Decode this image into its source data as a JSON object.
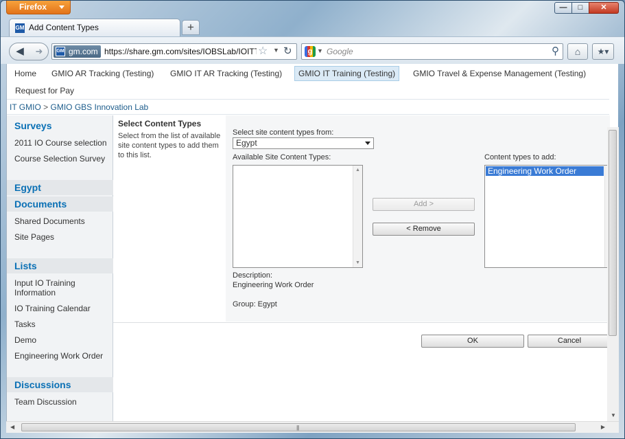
{
  "browser": {
    "menu_button": "Firefox",
    "window_controls": {
      "minimize": "—",
      "maximize": "□",
      "close": "✕"
    },
    "tab": {
      "title": "Add Content Types",
      "favicon_text": "GM"
    },
    "new_tab": "+",
    "identity_label": "gm.com",
    "identity_icon_text": "GM",
    "url": "https://share.gm.com/sites/IOBSLab/IOITT",
    "search_placeholder": "Google",
    "search_engine_icon": "g",
    "icons": {
      "back": "back-arrow-icon",
      "forward": "forward-arrow-icon",
      "star": "bookmark-star-icon",
      "reload": "reload-icon",
      "search": "magnifier-icon",
      "home": "home-icon",
      "bookmarks": "bookmarks-menu-icon"
    }
  },
  "topnav": {
    "items": [
      {
        "label": "Home"
      },
      {
        "label": "GMIO AR Tracking (Testing)"
      },
      {
        "label": "GMIO IT AR Tracking (Testing)"
      },
      {
        "label": "GMIO IT Training (Testing)",
        "selected": true
      },
      {
        "label": "GMIO Travel & Expense Management (Testing)"
      },
      {
        "label": "Request for Pay"
      }
    ]
  },
  "breadcrumb": {
    "parent": "IT GMIO",
    "separator": ">",
    "current": "GMIO GBS Innovation Lab"
  },
  "quicklaunch": {
    "surveys_heading": "Surveys",
    "surveys": [
      "2011 IO Course selection",
      "Course Selection Survey"
    ],
    "egypt_heading": "Egypt",
    "documents_heading": "Documents",
    "documents": [
      "Shared Documents",
      "Site Pages"
    ],
    "lists_heading": "Lists",
    "lists": [
      "Input IO Training Information",
      "IO Training Calendar",
      "Tasks",
      "Demo",
      "Engineering Work Order"
    ],
    "discussions_heading": "Discussions",
    "discussions": [
      "Team Discussion"
    ]
  },
  "form": {
    "section_title": "Select Content Types",
    "section_body": "Select from the list of available site content types to add them to this list.",
    "select_from_label": "Select site content types from:",
    "select_from_value": "Egypt",
    "available_label": "Available Site Content Types:",
    "available_items": [],
    "add_button": "Add >",
    "remove_button": "< Remove",
    "to_add_label": "Content types to add:",
    "to_add_items": [
      "Engineering Work Order"
    ],
    "description_label": "Description:",
    "description_value": "Engineering Work Order",
    "group_text": "Group: Egypt",
    "ok_button": "OK",
    "cancel_button": "Cancel"
  },
  "colors": {
    "link_blue": "#0a70b5",
    "selected_item": "#3a7bd5",
    "firefox_orange": "#e2731a"
  }
}
